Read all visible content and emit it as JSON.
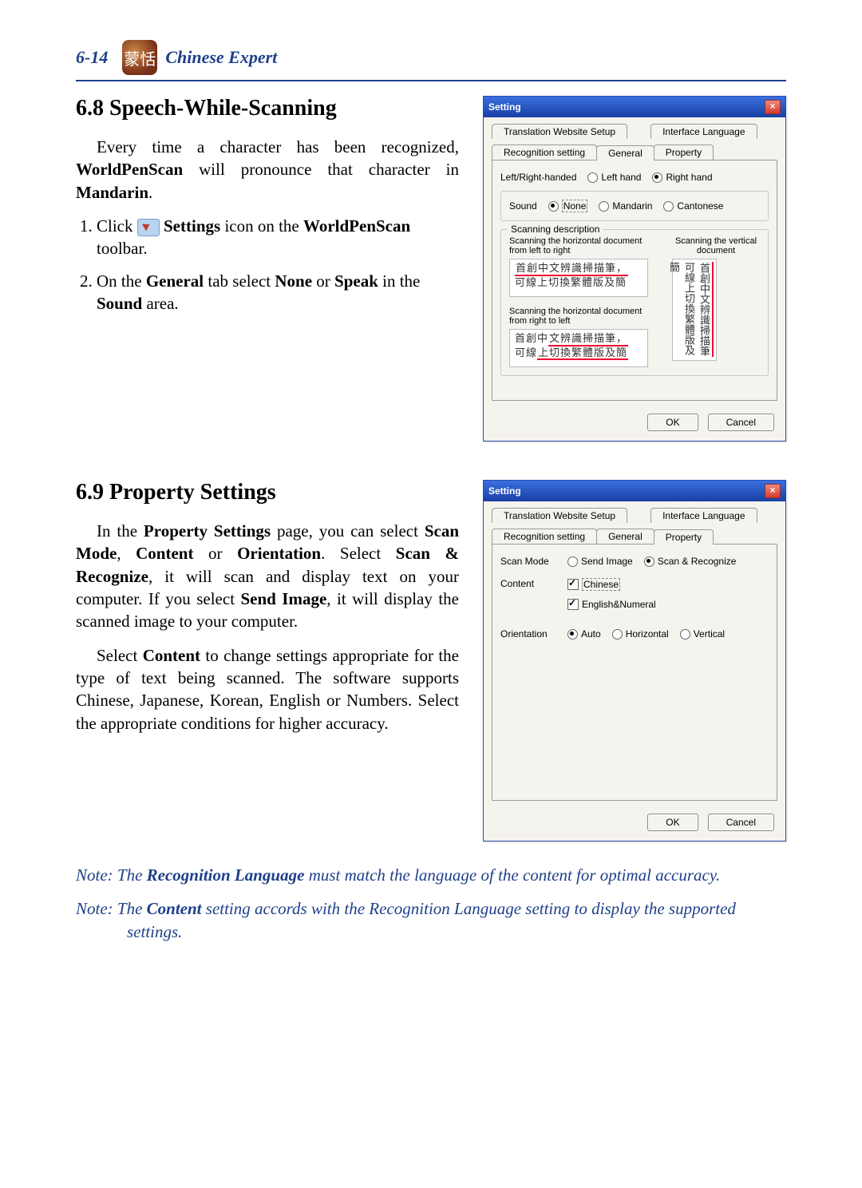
{
  "header": {
    "page_number": "6-14",
    "title": "Chinese Expert"
  },
  "section68": {
    "heading": "6.8  Speech-While-Scanning",
    "intro_parts": {
      "t1": "Every time a character has been recognized, ",
      "b1": "WorldPenScan",
      "t2": " will pronounce that character in ",
      "b2": "Mandarin",
      "t3": "."
    },
    "step1": {
      "a": "Click ",
      "b": " Settings",
      "c": " icon on the ",
      "d": "WorldPenScan",
      "e": " toolbar."
    },
    "step2": {
      "a": "On the ",
      "b": "General",
      "c": " tab select ",
      "d": "None",
      "e": " or ",
      "f": "Speak",
      "g": " in the ",
      "h": "Sound",
      "i": " area."
    }
  },
  "dialog1": {
    "title": "Setting",
    "tabs": {
      "tws": "Translation Website Setup",
      "il": "Interface Language",
      "rs": "Recognition setting",
      "general": "General",
      "property": "Property"
    },
    "handed": {
      "label": "Left/Right-handed",
      "left": "Left hand",
      "right": "Right hand"
    },
    "sound": {
      "label": "Sound",
      "none": "None",
      "mandarin": "Mandarin",
      "cantonese": "Cantonese"
    },
    "scan_desc": {
      "group": "Scanning description",
      "h_ltr": "Scanning the horizontal document from left to right",
      "h_rtl": "Scanning the horizontal document from right to left",
      "v": "Scanning the vertical document",
      "sample_line1": "首創中文辨識掃描筆，",
      "sample_line2": "可線上切換繁體版及簡",
      "sample_v": "首創中文辨識掃描筆可線上切換繁體版及簡"
    },
    "ok": "OK",
    "cancel": "Cancel"
  },
  "section69": {
    "heading": "6.9  Property Settings",
    "p1": {
      "a": "In the ",
      "b": "Property Settings",
      "c": " page, you can select ",
      "d": "Scan Mode",
      "e": ", ",
      "f": "Content",
      "g": " or ",
      "h": "Orientation",
      "i": ". Select ",
      "j": "Scan & Recognize",
      "k": ", it will scan and display text on your computer. If you select ",
      "l": "Send Image",
      "m": ", it will display the scanned image to your computer."
    },
    "p2": {
      "a": "Select ",
      "b": "Content",
      "c": " to change settings appropriate for the type of text being scanned. The software supports Chinese, Japanese, Korean, English or Numbers. Select the appropriate conditions for higher accuracy."
    }
  },
  "dialog2": {
    "title": "Setting",
    "tabs": {
      "tws": "Translation Website Setup",
      "il": "Interface Language",
      "rs": "Recognition setting",
      "general": "General",
      "property": "Property"
    },
    "scan_mode": {
      "label": "Scan Mode",
      "send": "Send Image",
      "sr": "Scan & Recognize"
    },
    "content": {
      "label": "Content",
      "chinese": "Chinese",
      "eng": "English&Numeral"
    },
    "orientation": {
      "label": "Orientation",
      "auto": "Auto",
      "h": "Horizontal",
      "v": "Vertical"
    },
    "ok": "OK",
    "cancel": "Cancel"
  },
  "notes": {
    "n1": {
      "lead": "Note: The ",
      "b": "Recognition Language",
      "tail": " must match the language of the content for optimal accuracy."
    },
    "n2": {
      "lead": "Note: The ",
      "b": "Content",
      "tail": " setting accords with the Recognition Language setting to display the supported settings."
    }
  }
}
